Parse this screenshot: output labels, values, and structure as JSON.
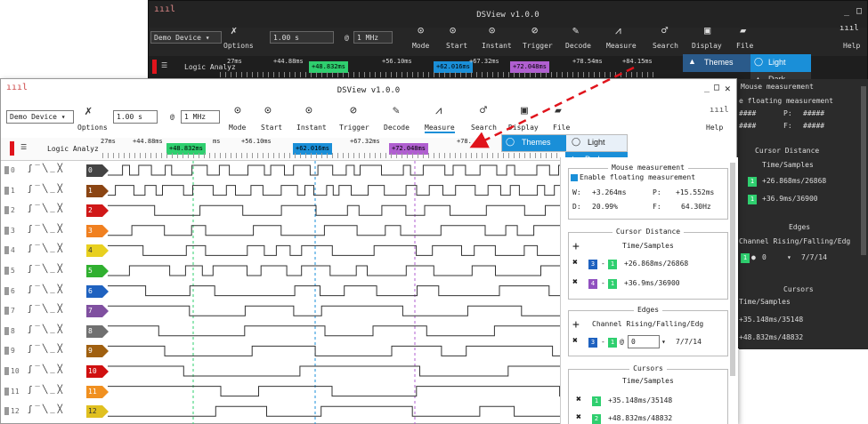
{
  "colors": {
    "blue": "#1a8fd8",
    "green": "#2fcf6f",
    "purple": "#b05fd0",
    "arrow": "#e0141c",
    "chan": [
      "#444444",
      "#8b4513",
      "#d01818",
      "#f08020",
      "#e8d020",
      "#30b030",
      "#1f62c0",
      "#8050a0",
      "#707070",
      "#a06010",
      "#d01010",
      "#f09020",
      "#e0c020"
    ]
  },
  "dark": {
    "title": "DSView v1.0.0",
    "device": "Demo Device",
    "time": "1.00 s",
    "at": "@",
    "rate": "1 MHz",
    "toolbar": [
      "Options",
      "Mode",
      "Start",
      "Instant",
      "Trigger",
      "Decode",
      "Measure",
      "Search",
      "Display",
      "File"
    ],
    "help": "Help",
    "logic": "Logic Analyz",
    "ruler": {
      "t1": "27ms",
      "t2": "+44.88ms",
      "m1": "+48.832ms",
      "t3": "+56.10ms",
      "m2": "+62.016ms",
      "t4": "+67.32ms",
      "m3": "+72.048ms",
      "t5": "+78.54ms",
      "t6": "+84.15ms"
    },
    "menu": {
      "themes": "Themes",
      "light": "Light",
      "dark": "Dark"
    },
    "panel": {
      "mouse": "Mouse measurement",
      "float": "e floating measurement",
      "w": "####",
      "p": "P:",
      "pv": "#####",
      "d": "####",
      "f": "F:",
      "fv": "#####",
      "cursor_title": "Cursor Distance",
      "ts": "Time/Samples",
      "c1": "+26.868ms/26868",
      "c2": "+36.9ms/36900",
      "edges": "Edges",
      "edge_head": "Channel  Rising/Falling/Edg",
      "edge_ch": "0",
      "edge_val": "7/7/14",
      "cursors": "Cursors",
      "cts": "Time/Samples",
      "cur1": "+35.148ms/35148",
      "cur2": "+48.832ms/48832"
    }
  },
  "light": {
    "title": "DSView v1.0.0",
    "device": "Demo Device",
    "time": "1.00 s",
    "at": "@",
    "rate": "1 MHz",
    "toolbar": [
      "Options",
      "Mode",
      "Start",
      "Instant",
      "Trigger",
      "Decode",
      "Measure",
      "Search",
      "Display",
      "File"
    ],
    "help": "Help",
    "logic": "Logic Analyz",
    "ruler": {
      "t1": "27ms",
      "t2": "+44.88ms",
      "m1": "+48.832ms",
      "t2b": "ms",
      "t3": "+56.10ms",
      "m2": "+62.016ms",
      "t4": "+67.32ms",
      "m3": "+72.048ms",
      "t5": "+78."
    },
    "menu": {
      "themes": "Themes",
      "light": "Light",
      "dark": "Dark"
    },
    "channels": [
      "0",
      "1",
      "2",
      "3",
      "4",
      "5",
      "6",
      "7",
      "8",
      "9",
      "10",
      "11",
      "12"
    ],
    "trig": "ʃ‾╲_╳",
    "panel": {
      "mouse": "Mouse measurement",
      "float": "Enable floating measurement",
      "w": "W:",
      "wv": "+3.264ms",
      "p": "P:",
      "pv": "+15.552ms",
      "d": "D:",
      "dv": "20.99%",
      "f": "F:",
      "fv": "64.30Hz",
      "cursor_title": "Cursor Distance",
      "ts": "Time/Samples",
      "r1a": "3",
      "r1b": "1",
      "r1v": "+26.868ms/26868",
      "r2a": "4",
      "r2b": "1",
      "r2v": "+36.9ms/36900",
      "edges": "Edges",
      "edge_head": "Channel  Rising/Falling/Edg",
      "ea": "3",
      "eb": "1",
      "eat": "@",
      "ech": "0",
      "eval": "7/7/14",
      "cursors": "Cursors",
      "cts": "Time/Samples",
      "k1": "1",
      "k1v": "+35.148ms/35148",
      "k2": "2",
      "k2v": "+48.832ms/48832"
    }
  }
}
